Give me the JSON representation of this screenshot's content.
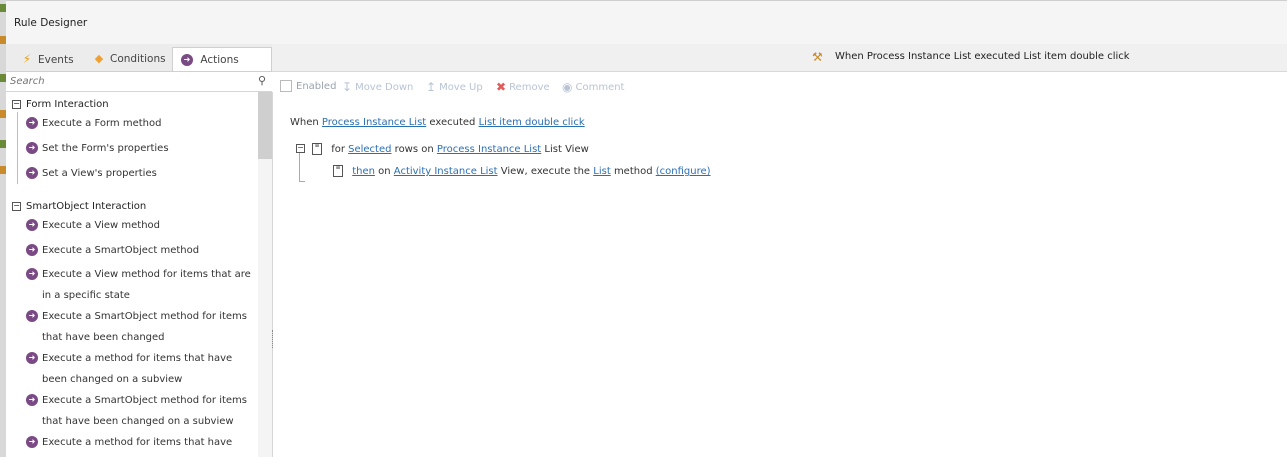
{
  "window": {
    "title": "Rule Designer"
  },
  "tabs": [
    {
      "label": "Events",
      "icon": "lightning-icon"
    },
    {
      "label": "Conditions",
      "icon": "diamond-icon"
    },
    {
      "label": "Actions",
      "icon": "arrow-circle-icon",
      "active": true
    }
  ],
  "rule_header": {
    "title": "When Process Instance List executed List item double click"
  },
  "search": {
    "placeholder": "Search"
  },
  "groups": [
    {
      "label": "Form Interaction",
      "items": [
        "Execute a Form method",
        "Set the Form's properties",
        "Set a View's properties"
      ]
    },
    {
      "label": "SmartObject Interaction",
      "items": [
        "Execute a View method",
        "Execute a SmartObject method",
        "Execute a View method for items that are in a specific state",
        "Execute a SmartObject method for items that have been changed",
        "Execute a method for items that have been changed on a subview",
        "Execute a SmartObject method for items that have been changed on a subview",
        "Execute a method for items that have been"
      ]
    }
  ],
  "toolbar": {
    "enabled": "Enabled",
    "move_down": "Move Down",
    "move_up": "Move Up",
    "remove": "Remove",
    "comment": "Comment"
  },
  "rule": {
    "line1": {
      "w1": "When",
      "l1": "Process Instance List",
      "w2": "executed",
      "l2": "List item double click"
    },
    "line2": {
      "w1": "for",
      "l1": "Selected",
      "w2": "rows on",
      "l2": "Process Instance List",
      "w3": "List View"
    },
    "line3": {
      "l1": "then",
      "w1": "on",
      "l2": "Activity Instance List",
      "w2": "View, execute the",
      "l3": "List",
      "w3": "method",
      "l4": "(configure)"
    }
  },
  "colors": {
    "accent": "#7a4a84",
    "link": "#2b6fb3",
    "remove": "#e35a5a"
  }
}
